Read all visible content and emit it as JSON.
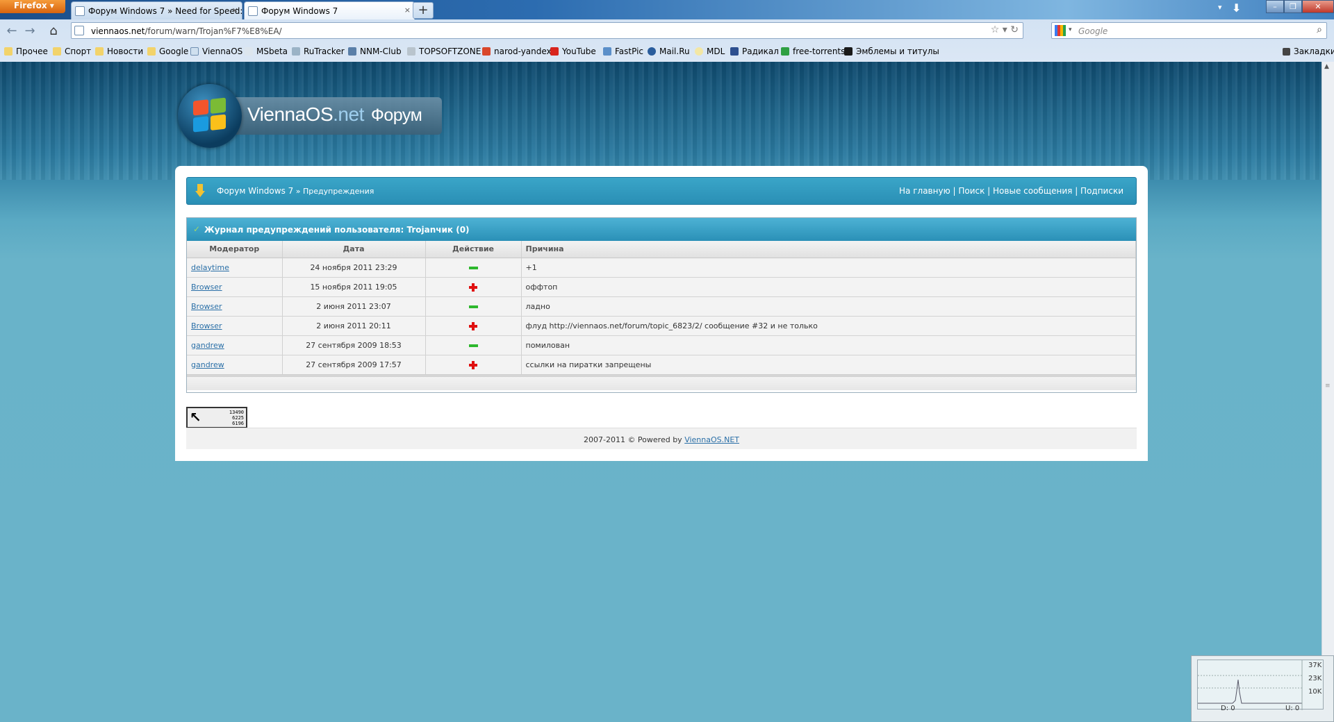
{
  "browser": {
    "menu_button": "Firefox",
    "tabs": [
      {
        "title": "Форум Windows 7 » Need for Speed: ...",
        "active": false
      },
      {
        "title": "Форум Windows 7",
        "active": true
      }
    ],
    "new_tab_label": "+",
    "url_host": "viennaos.net",
    "url_path": "/forum/warn/Trojan%F7%E8%EA/",
    "search_placeholder": "Google",
    "bookmarks": [
      "Прочее",
      "Спорт",
      "Новости",
      "Google",
      "ViennaOS",
      "MSbeta",
      "RuTracker",
      "NNM-Club",
      "TOPSOFTZONE",
      "narod-yandex",
      "YouTube",
      "FastPic",
      "Mail.Ru",
      "MDL",
      "Радикал",
      "free-torrents",
      "Эмблемы и титулы"
    ],
    "bookmarks_menu": "Закладки"
  },
  "site": {
    "logo_main": "ViennaOS",
    "logo_net": ".net",
    "logo_forum": "Форум"
  },
  "breadcrumb": {
    "root": "Форум Windows 7",
    "sep": " » ",
    "current": "Предупреждения"
  },
  "toplinks": [
    "На главную",
    "Поиск",
    "Новые сообщения",
    "Подписки"
  ],
  "warn_log": {
    "title": "Журнал предупреждений пользователя: Trojanчик (0)",
    "columns": [
      "Модератор",
      "Дата",
      "Действие",
      "Причина"
    ],
    "rows": [
      {
        "moderator": "delaytime",
        "date": "24 ноября 2011 23:29",
        "action": "minus",
        "reason": "+1"
      },
      {
        "moderator": "Browser",
        "date": "15 ноября 2011 19:05",
        "action": "plus",
        "reason": "оффтоп"
      },
      {
        "moderator": "Browser",
        "date": "2 июня 2011 23:07",
        "action": "minus",
        "reason": "ладно"
      },
      {
        "moderator": "Browser",
        "date": "2 июня 2011 20:11",
        "action": "plus",
        "reason": "флуд http://viennaos.net/forum/topic_6823/2/ сообщение #32 и не только"
      },
      {
        "moderator": "gandrew",
        "date": "27 сентября 2009 18:53",
        "action": "minus",
        "reason": "помилован"
      },
      {
        "moderator": "gandrew",
        "date": "27 сентября 2009 17:57",
        "action": "plus",
        "reason": "ссылки на пиратки запрещены"
      }
    ]
  },
  "counter": {
    "lines": [
      "13490",
      "6225",
      "6196"
    ]
  },
  "footer": {
    "text": "2007-2011 © Powered by ",
    "link": "ViennaOS.NET"
  },
  "net_monitor": {
    "scale": [
      "37K",
      "23K",
      "10K"
    ],
    "down": "D: 0",
    "up": "U: 0"
  },
  "colors": {
    "page_bg": "#6ab3c9",
    "header_bar": "#2a90b7",
    "link": "#2a6fa7",
    "plus": "#e01010",
    "minus": "#2db82d"
  }
}
